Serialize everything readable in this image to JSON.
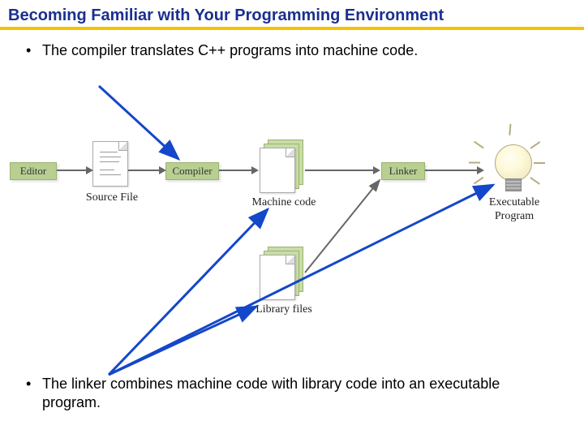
{
  "title": "Becoming Familiar with Your Programming Environment",
  "bullets": {
    "top": "The compiler translates C++ programs into machine code.",
    "bottom": "The linker combines machine code with library code into an executable program."
  },
  "diagram": {
    "boxes": {
      "editor": "Editor",
      "compiler": "Compiler",
      "linker": "Linker"
    },
    "labels": {
      "source_file": "Source File",
      "machine_code": "Machine code",
      "library_files": "Library files",
      "executable_program": "Executable Program"
    }
  }
}
